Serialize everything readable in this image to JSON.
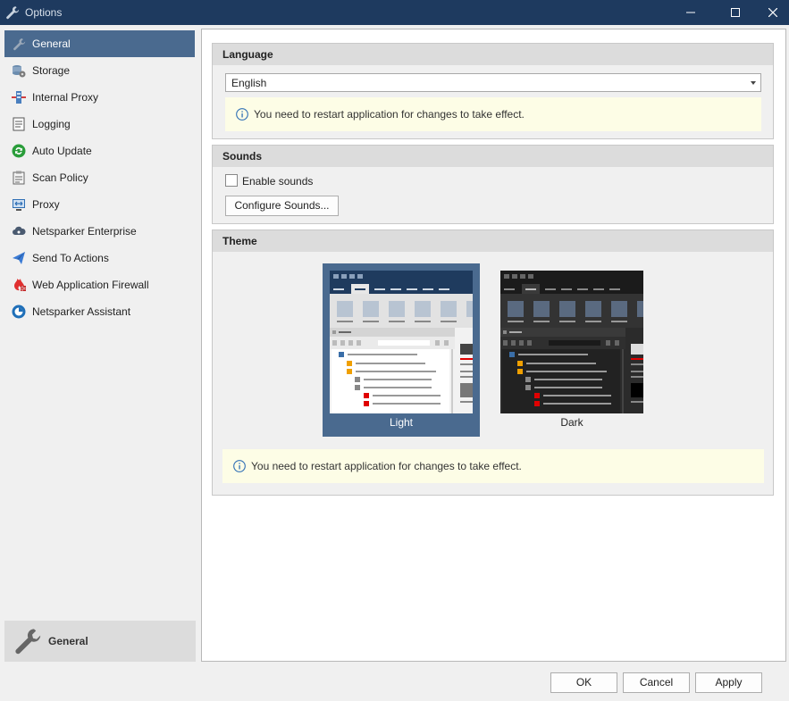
{
  "window": {
    "title": "Options"
  },
  "sidebar": {
    "items": [
      {
        "label": "General",
        "icon": "wrench-icon",
        "active": true
      },
      {
        "label": "Storage",
        "icon": "storage-icon"
      },
      {
        "label": "Internal Proxy",
        "icon": "internal-proxy-icon"
      },
      {
        "label": "Logging",
        "icon": "logging-icon"
      },
      {
        "label": "Auto Update",
        "icon": "auto-update-icon"
      },
      {
        "label": "Scan Policy",
        "icon": "scan-policy-icon"
      },
      {
        "label": "Proxy",
        "icon": "proxy-icon"
      },
      {
        "label": "Netsparker Enterprise",
        "icon": "enterprise-icon"
      },
      {
        "label": "Send To Actions",
        "icon": "send-icon"
      },
      {
        "label": "Web Application Firewall",
        "icon": "firewall-icon"
      },
      {
        "label": "Netsparker Assistant",
        "icon": "assistant-icon"
      }
    ],
    "footer": {
      "label": "General",
      "icon": "wrench-icon"
    }
  },
  "language": {
    "header": "Language",
    "selected": "English",
    "info": "You need to restart application for changes to take effect."
  },
  "sounds": {
    "header": "Sounds",
    "enable_label": "Enable sounds",
    "enable_checked": false,
    "configure_button": "Configure Sounds..."
  },
  "theme": {
    "header": "Theme",
    "options": [
      {
        "label": "Light",
        "selected": true
      },
      {
        "label": "Dark",
        "selected": false
      }
    ],
    "info": "You need to restart application for changes to take effect."
  },
  "buttons": {
    "ok": "OK",
    "cancel": "Cancel",
    "apply": "Apply"
  },
  "colors": {
    "titlebar": "#1e3a5f",
    "selection": "#4a6a8f",
    "info_background": "#fdfde6"
  }
}
